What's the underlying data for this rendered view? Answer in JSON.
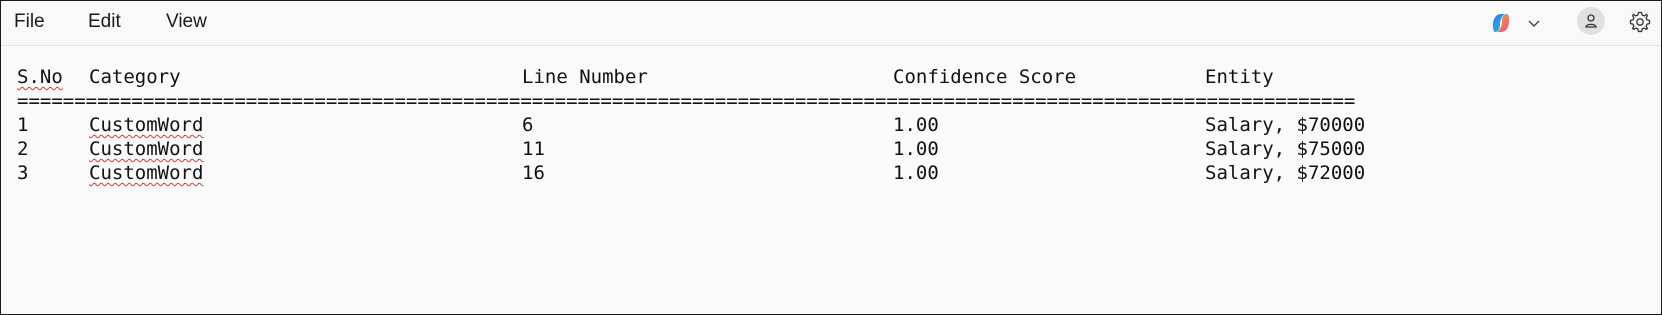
{
  "menu": {
    "file": "File",
    "edit": "Edit",
    "view": "View"
  },
  "toolbar": {
    "copilot_icon": "copilot-icon",
    "chevron_icon": "chevron-down-icon",
    "account_icon": "account-icon",
    "settings_icon": "gear-icon"
  },
  "colors": {
    "spellcheck": "#e0342f",
    "text": "#111111",
    "background": "#fafafa"
  },
  "document": {
    "headers": [
      "S.No",
      "Category",
      "Line Number",
      "Confidence Score",
      "Entity"
    ],
    "separator": "=====================================================================================================================",
    "rows": [
      [
        "1",
        "CustomWord",
        "6",
        "1.00",
        "Salary, $70000"
      ],
      [
        "2",
        "CustomWord",
        "11",
        "1.00",
        "Salary, $75000"
      ],
      [
        "3",
        "CustomWord",
        "16",
        "1.00",
        "Salary, $72000"
      ]
    ]
  }
}
